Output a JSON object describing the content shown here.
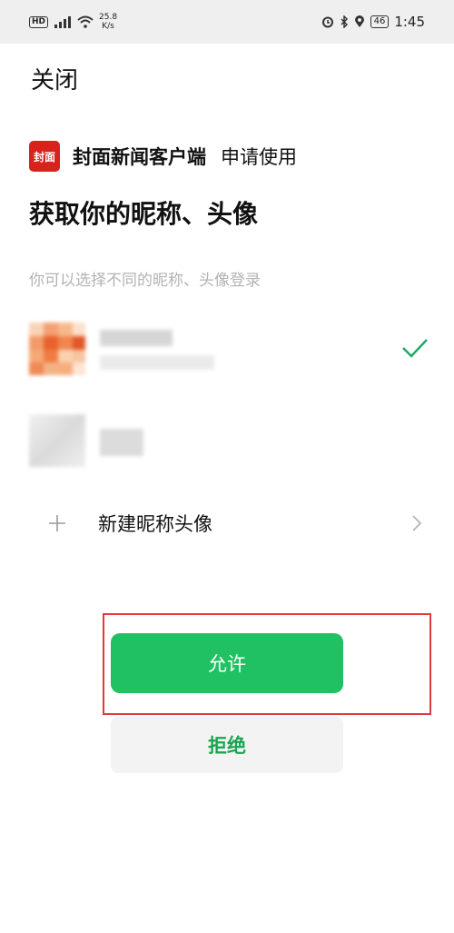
{
  "status_bar": {
    "hd_label": "HD",
    "network_speed": "25.8",
    "speed_unit": "K/s",
    "battery": "46",
    "time": "1:45"
  },
  "header": {
    "close_label": "关闭"
  },
  "app": {
    "logo_text": "封面",
    "name": "封面新闻客户端",
    "action": "申请使用"
  },
  "main": {
    "title": "获取你的昵称、头像",
    "subtitle": "你可以选择不同的昵称、头像登录",
    "new_profile_label": "新建昵称头像"
  },
  "buttons": {
    "allow": "允许",
    "deny": "拒绝"
  },
  "colors": {
    "accent_green": "#20c162",
    "deny_text": "#17a54e",
    "highlight_red": "#e03a3a",
    "logo_red": "#d9221c"
  }
}
